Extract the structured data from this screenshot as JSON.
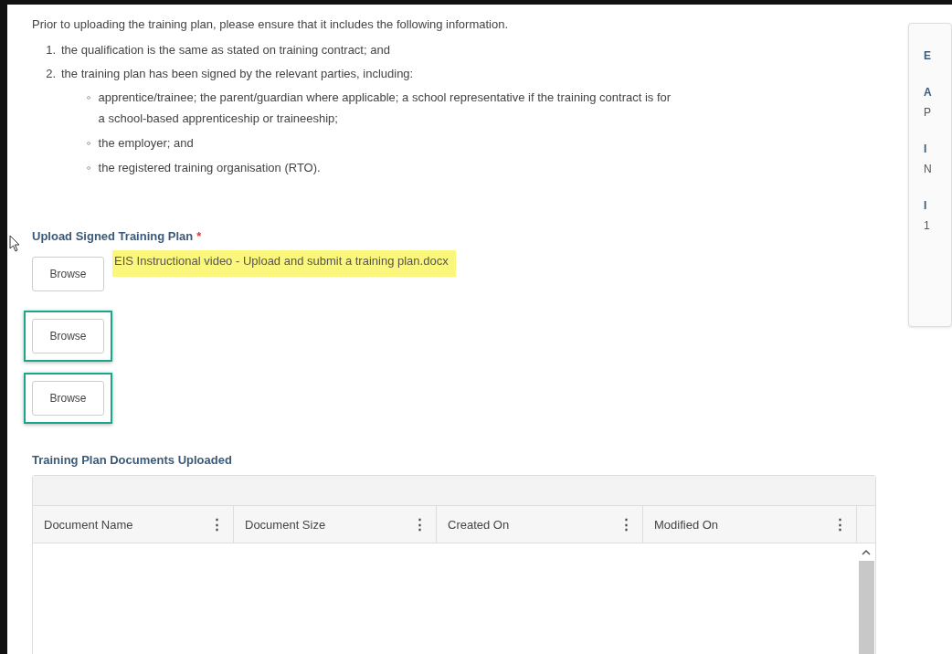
{
  "intro": "Prior to uploading the training plan, please ensure that it includes the following information.",
  "requirements": [
    {
      "number": "1.",
      "text": "the qualification is the same as stated on training contract; and"
    },
    {
      "number": "2.",
      "text": "the training plan has been signed by the relevant parties, including:",
      "children": [
        {
          "bullet": "◦",
          "text": "apprentice/trainee; the parent/guardian where applicable; a school representative if the training contract is for a school-based apprenticeship or traineeship;"
        },
        {
          "bullet": "◦",
          "text": "the employer; and"
        },
        {
          "bullet": "◦",
          "text": "the registered training organisation (RTO)."
        }
      ]
    }
  ],
  "upload": {
    "label": "Upload Signed Training Plan",
    "required_mark": "*",
    "rows": [
      {
        "button": "Browse",
        "file": "EIS Instructional video - Upload and submit a training plan.docx",
        "highlighted": true,
        "outlined": false
      },
      {
        "button": "Browse",
        "outlined": true
      },
      {
        "button": "Browse",
        "outlined": true
      }
    ]
  },
  "documents": {
    "title": "Training Plan Documents Uploaded",
    "columns": [
      {
        "label": "Document Name",
        "menu": "⋮"
      },
      {
        "label": "Document Size",
        "menu": "⋮"
      },
      {
        "label": "Created On",
        "menu": "⋮"
      },
      {
        "label": "Modified On",
        "menu": "⋮"
      }
    ]
  },
  "side_panel": {
    "items": [
      {
        "kind": "heading",
        "text": "E"
      },
      {
        "kind": "heading",
        "text": "A"
      },
      {
        "kind": "value",
        "text": "P"
      },
      {
        "kind": "heading",
        "text": "I"
      },
      {
        "kind": "value",
        "text": "N"
      },
      {
        "kind": "heading",
        "text": "I"
      },
      {
        "kind": "value",
        "text": "1"
      }
    ]
  }
}
